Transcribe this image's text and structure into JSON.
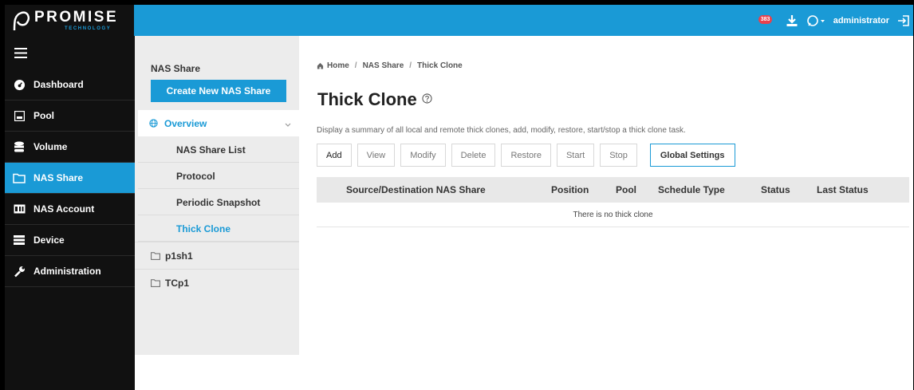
{
  "header": {
    "brand": "PROMISE",
    "brand_sub": "TECHNOLOGY",
    "notification_count": "383",
    "username": "administrator",
    "colors": {
      "accent": "#1a9ad6",
      "dark": "#111111",
      "badge": "#e8424d"
    }
  },
  "leftnav": {
    "items": [
      {
        "label": "Dashboard",
        "icon": "dashboard-icon"
      },
      {
        "label": "Pool",
        "icon": "pool-icon"
      },
      {
        "label": "Volume",
        "icon": "volume-icon"
      },
      {
        "label": "NAS Share",
        "icon": "folder-icon",
        "active": true
      },
      {
        "label": "NAS Account",
        "icon": "account-icon"
      },
      {
        "label": "Device",
        "icon": "device-icon"
      },
      {
        "label": "Administration",
        "icon": "wrench-icon"
      }
    ]
  },
  "subnav": {
    "title": "NAS Share",
    "create_label": "Create New NAS Share",
    "overview_label": "Overview",
    "children": [
      {
        "label": "NAS Share List"
      },
      {
        "label": "Protocol"
      },
      {
        "label": "Periodic Snapshot"
      },
      {
        "label": "Thick Clone",
        "active": true
      }
    ],
    "folders": [
      {
        "label": "p1sh1"
      },
      {
        "label": "TCp1"
      }
    ]
  },
  "main": {
    "breadcrumb": [
      "Home",
      "NAS Share",
      "Thick Clone"
    ],
    "title": "Thick Clone",
    "description": "Display a summary of all local and remote thick clones, add, modify, restore, start/stop a thick clone task.",
    "toolbar": {
      "add": "Add",
      "view": "View",
      "modify": "Modify",
      "delete": "Delete",
      "restore": "Restore",
      "start": "Start",
      "stop": "Stop",
      "global_settings": "Global Settings"
    },
    "table": {
      "columns": [
        "Source/Destination NAS Share",
        "Position",
        "Pool",
        "Schedule Type",
        "Status",
        "Last Status"
      ],
      "empty_message": "There is no thick clone"
    }
  }
}
